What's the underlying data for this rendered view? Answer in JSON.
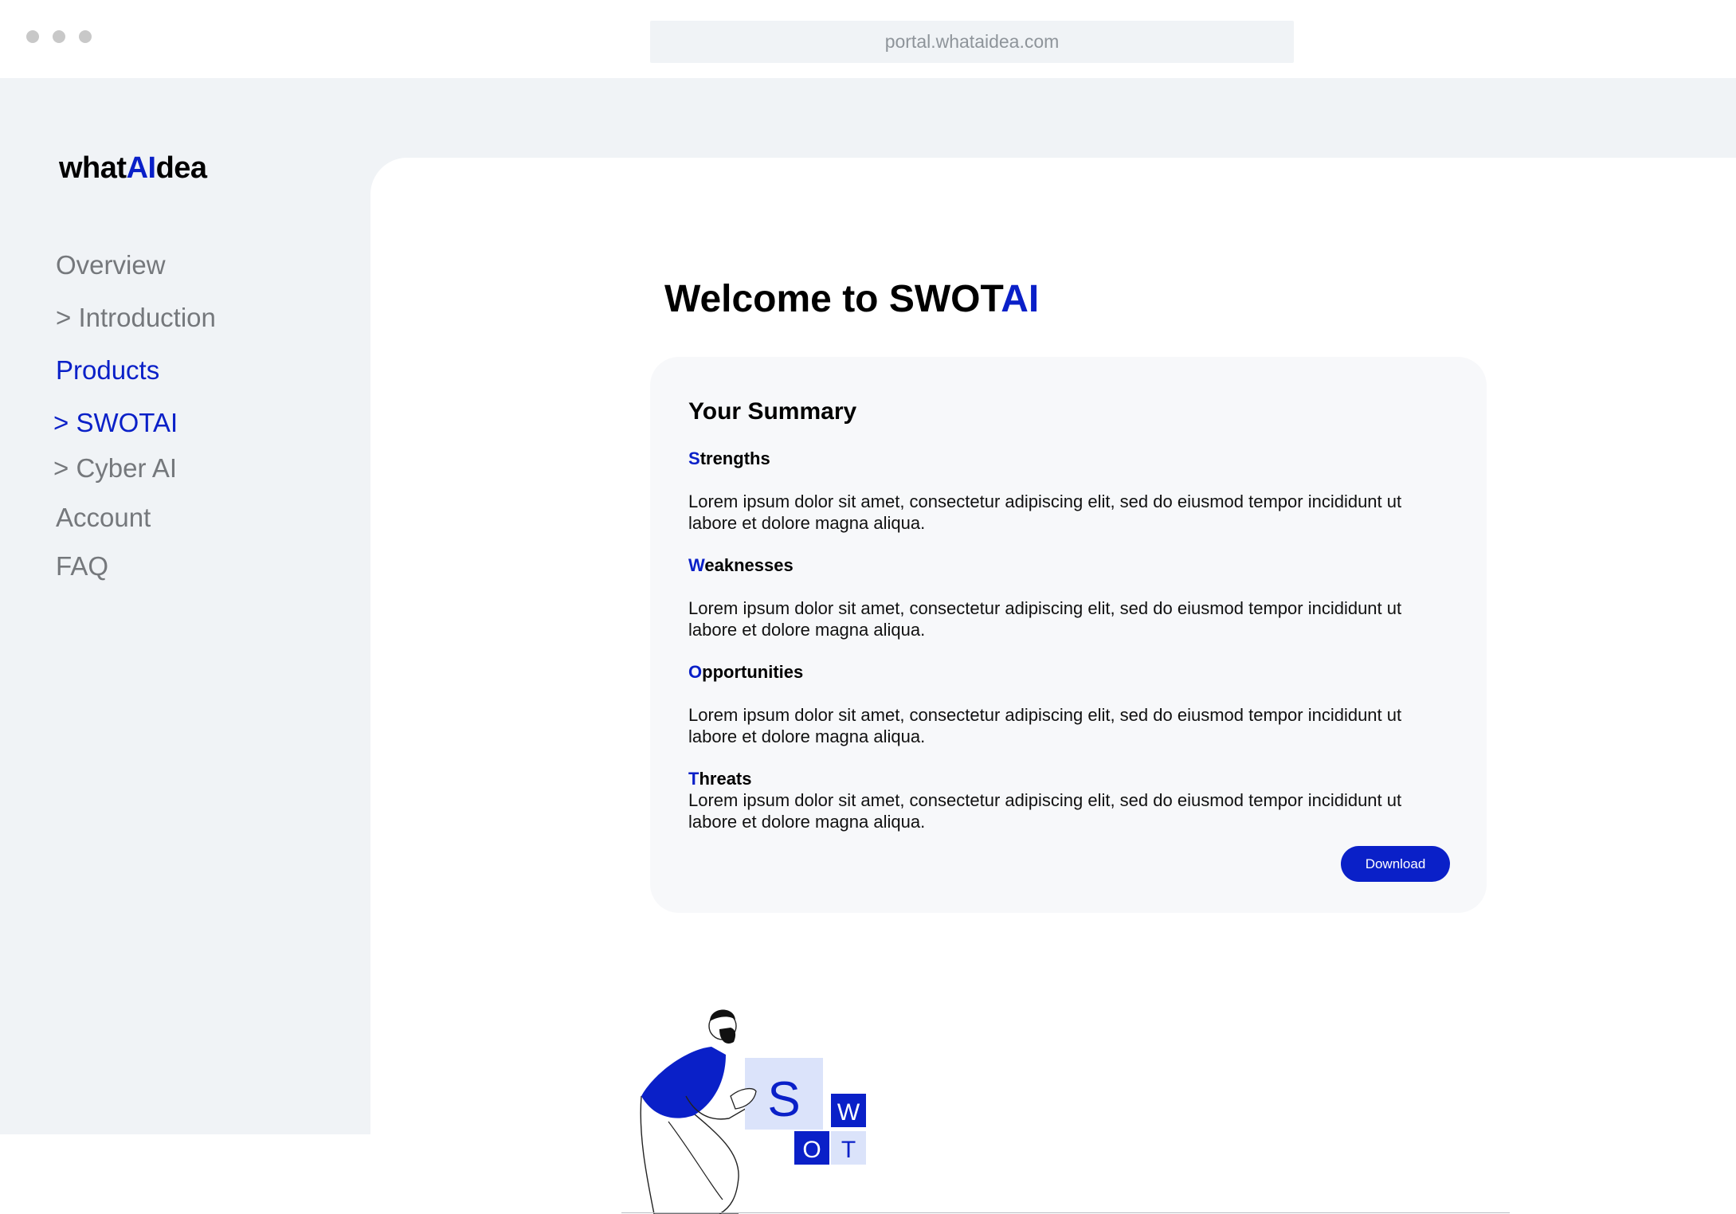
{
  "browser": {
    "url": "portal.whataidea.com"
  },
  "logo": {
    "prefix": "what",
    "accent": "AI",
    "suffix": "dea"
  },
  "sidebar": {
    "items": [
      {
        "label": "Overview",
        "active": false
      },
      {
        "label": "> Introduction",
        "active": false
      },
      {
        "label": "Products",
        "active": true
      },
      {
        "label": "> SWOTAI",
        "active": true
      },
      {
        "label": "> Cyber AI",
        "active": false
      },
      {
        "label": "Account",
        "active": false
      },
      {
        "label": "FAQ",
        "active": false
      }
    ]
  },
  "main": {
    "title_prefix": "Welcome to SWOT",
    "title_accent": "AI",
    "summary": {
      "heading": "Your Summary",
      "sections": [
        {
          "initial": "S",
          "rest": "trengths",
          "text": "Lorem ipsum dolor sit amet, consectetur adipiscing elit, sed do eiusmod tempor incididunt ut labore et dolore magna aliqua."
        },
        {
          "initial": "W",
          "rest": "eaknesses",
          "text": "Lorem ipsum dolor sit amet, consectetur adipiscing elit, sed do eiusmod tempor incididunt ut labore et dolore magna aliqua."
        },
        {
          "initial": "O",
          "rest": "pportunities",
          "text": "Lorem ipsum dolor sit amet, consectetur adipiscing elit, sed do eiusmod tempor incididunt ut labore et dolore magna aliqua."
        },
        {
          "initial": "T",
          "rest": "hreats",
          "text": "Lorem ipsum dolor sit amet, consectetur adipiscing elit, sed do eiusmod tempor incididunt ut labore et dolore magna aliqua."
        }
      ],
      "download_label": "Download"
    },
    "illustration": {
      "tiles": [
        "S",
        "W",
        "O",
        "T"
      ]
    }
  },
  "colors": {
    "accent": "#0a20c8",
    "sidebar_bg": "#f0f3f6",
    "nav_text": "#75787c",
    "card_bg": "#f7f8fa",
    "tile_light": "#dbe3fa"
  }
}
